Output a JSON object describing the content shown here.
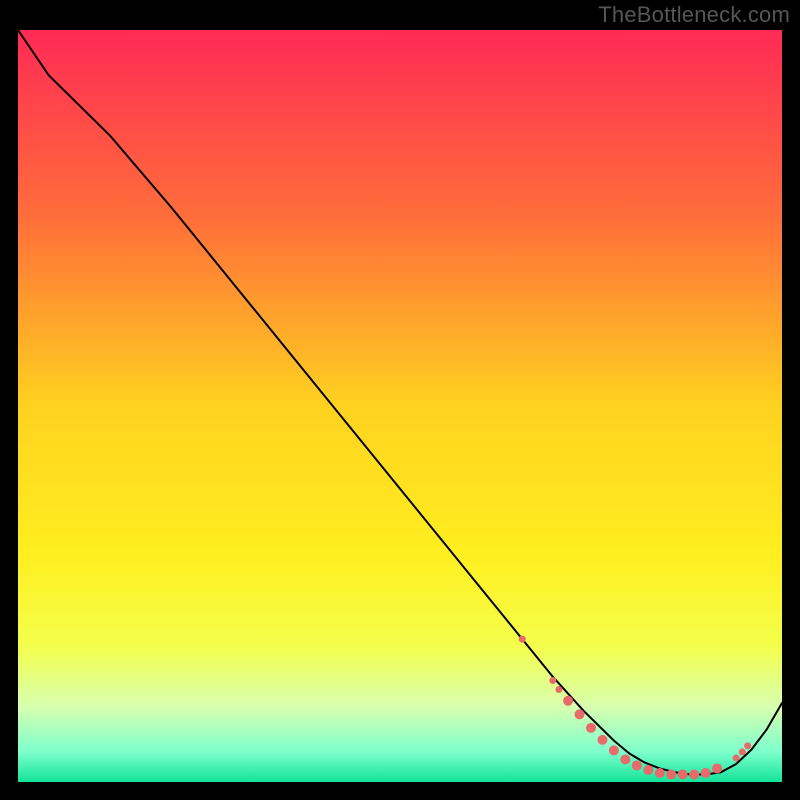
{
  "attribution": "TheBottleneck.com",
  "chart_data": {
    "type": "line",
    "title": "",
    "xlabel": "",
    "ylabel": "",
    "xlim": [
      0,
      100
    ],
    "ylim": [
      0,
      100
    ],
    "grid": false,
    "legend": false,
    "gradient_stops": [
      {
        "offset": 0.0,
        "color": "#ff2a55"
      },
      {
        "offset": 0.25,
        "color": "#ff6e3a"
      },
      {
        "offset": 0.5,
        "color": "#ffd21f"
      },
      {
        "offset": 0.7,
        "color": "#ffef20"
      },
      {
        "offset": 0.82,
        "color": "#f3ff4c"
      },
      {
        "offset": 0.9,
        "color": "#d8ffb0"
      },
      {
        "offset": 0.96,
        "color": "#7dffcc"
      },
      {
        "offset": 1.0,
        "color": "#12e39a"
      }
    ],
    "series": [
      {
        "name": "bottleneck-curve",
        "color": "#000000",
        "width": 2,
        "x": [
          0,
          4,
          8,
          12,
          20,
          30,
          40,
          50,
          60,
          66,
          70,
          74,
          78,
          80,
          82,
          84,
          86,
          88,
          90,
          92,
          94,
          96,
          98,
          100
        ],
        "y": [
          100,
          94,
          90,
          86,
          76.5,
          64,
          51.5,
          39,
          26.5,
          19,
          14,
          9.5,
          5.5,
          3.8,
          2.6,
          1.8,
          1.3,
          1.0,
          1.0,
          1.3,
          2.4,
          4.3,
          7.0,
          10.5
        ]
      }
    ],
    "markers": {
      "name": "optimal-range-dots",
      "color": "#e86a6a",
      "radius_small": 3.5,
      "radius_large": 5.0,
      "points": [
        {
          "x": 66,
          "y": 19.0,
          "r": "small"
        },
        {
          "x": 70,
          "y": 13.5,
          "r": "small"
        },
        {
          "x": 70.8,
          "y": 12.3,
          "r": "small"
        },
        {
          "x": 72,
          "y": 10.8,
          "r": "large"
        },
        {
          "x": 73.5,
          "y": 9.0,
          "r": "large"
        },
        {
          "x": 75,
          "y": 7.2,
          "r": "large"
        },
        {
          "x": 76.5,
          "y": 5.6,
          "r": "large"
        },
        {
          "x": 78,
          "y": 4.2,
          "r": "large"
        },
        {
          "x": 79.5,
          "y": 3.0,
          "r": "large"
        },
        {
          "x": 81,
          "y": 2.2,
          "r": "large"
        },
        {
          "x": 82.5,
          "y": 1.6,
          "r": "large"
        },
        {
          "x": 84,
          "y": 1.2,
          "r": "large"
        },
        {
          "x": 85.5,
          "y": 1.0,
          "r": "large"
        },
        {
          "x": 87,
          "y": 1.0,
          "r": "large"
        },
        {
          "x": 88.5,
          "y": 1.0,
          "r": "large"
        },
        {
          "x": 90,
          "y": 1.2,
          "r": "large"
        },
        {
          "x": 91.5,
          "y": 1.8,
          "r": "large"
        },
        {
          "x": 94,
          "y": 3.2,
          "r": "small"
        },
        {
          "x": 94.8,
          "y": 4.0,
          "r": "small"
        },
        {
          "x": 95.5,
          "y": 4.8,
          "r": "small"
        }
      ]
    }
  }
}
